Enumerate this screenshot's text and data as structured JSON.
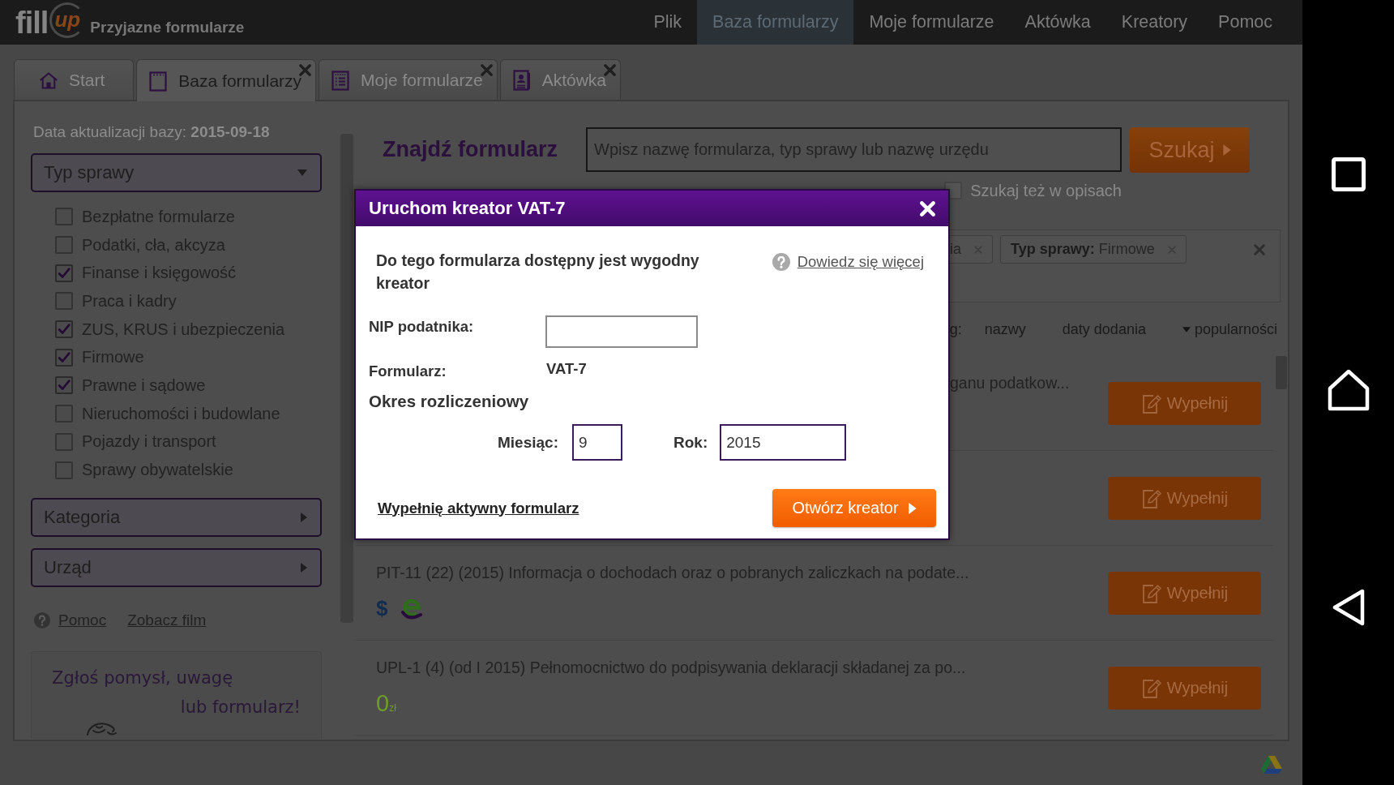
{
  "header": {
    "logo": {
      "word": "fill",
      "swash": "up",
      "tagline": "Przyjazne formularze"
    },
    "menu": [
      {
        "label": "Plik",
        "selected": false
      },
      {
        "label": "Baza formularzy",
        "selected": true
      },
      {
        "label": "Moje formularze",
        "selected": false
      },
      {
        "label": "Aktówka",
        "selected": false
      },
      {
        "label": "Kreatory",
        "selected": false
      },
      {
        "label": "Pomoc",
        "selected": false
      }
    ]
  },
  "tabs": [
    {
      "label": "Start",
      "kind": "home",
      "selected": false,
      "closable": false
    },
    {
      "label": "Baza formularzy",
      "kind": "notepad",
      "selected": true,
      "closable": true
    },
    {
      "label": "Moje formularze",
      "kind": "list",
      "selected": false,
      "closable": true
    },
    {
      "label": "Aktówka",
      "kind": "person-file",
      "selected": false,
      "closable": true
    }
  ],
  "sidebar": {
    "update_label": "Data aktualizacji bazy:",
    "update_date": "2015-09-18",
    "case_type": {
      "label": "Typ sprawy",
      "expanded": true,
      "options": [
        {
          "label": "Bezpłatne formularze",
          "checked": false
        },
        {
          "label": "Podatki, cła, akcyza",
          "checked": false
        },
        {
          "label": "Finanse i księgowość",
          "checked": true
        },
        {
          "label": "Praca i kadry",
          "checked": false
        },
        {
          "label": "ZUS, KRUS i ubezpieczenia",
          "checked": true
        },
        {
          "label": "Firmowe",
          "checked": true
        },
        {
          "label": "Prawne i sądowe",
          "checked": true
        },
        {
          "label": "Nieruchomości i budowlane",
          "checked": false
        },
        {
          "label": "Pojazdy i transport",
          "checked": false
        },
        {
          "label": "Sprawy obywatelskie",
          "checked": false
        }
      ]
    },
    "sections": [
      {
        "label": "Kategoria",
        "expanded": false
      },
      {
        "label": "Urząd",
        "expanded": false
      }
    ],
    "links": [
      {
        "label": "Pomoc",
        "kind": "help"
      },
      {
        "label": "Zobacz film",
        "kind": "plain"
      }
    ],
    "feedback": {
      "lines": [
        "Zgłoś pomysł, uwagę",
        "lub formularz!"
      ]
    }
  },
  "search": {
    "title": "Znajdź formularz",
    "placeholder": "Wpisz nazwę formularza, typ sprawy lub nazwę urzędu",
    "button": "Szukaj",
    "in_descriptions": {
      "label": "Szukaj też w opisach",
      "checked": false
    }
  },
  "filters": {
    "tags": [
      {
        "value": "ia"
      },
      {
        "label": "Typ sprawy:",
        "value": "Firmowe"
      }
    ]
  },
  "sort": {
    "label": "g:",
    "options": [
      {
        "label": "nazwy",
        "selected": false
      },
      {
        "label": "daty dodania",
        "selected": false
      },
      {
        "label": "popularności",
        "selected": true
      }
    ]
  },
  "results": [
    {
      "title": "ganu podatkow...",
      "button": "Wypełnij"
    },
    {
      "button": "Wypełnij"
    },
    {
      "title": "PIT-11 (22) (2015) Informacja o dochodach oraz o pobranych zaliczkach na podate...",
      "badges": [
        {
          "kind": "paid",
          "text": "$"
        },
        {
          "kind": "e-filing"
        }
      ],
      "button": "Wypełnij"
    },
    {
      "title": "UPL-1 (4) (od I 2015) Pełnomocnictwo do podpisywania deklaracji składanej za po...",
      "badges": [
        {
          "kind": "free",
          "text": "0",
          "unit": "zł"
        }
      ],
      "button": "Wypełnij"
    }
  ],
  "modal": {
    "title": "Uruchom kreator VAT-7",
    "intro": "Do tego formularza dostępny jest wygodny kreator",
    "help_link": "Dowiedz się więcej",
    "nip": {
      "label": "NIP podatnika:"
    },
    "form": {
      "label": "Formularz:",
      "value": "VAT-7"
    },
    "period": {
      "title": "Okres rozliczeniowy",
      "month": {
        "label": "Miesiąc:",
        "value": "9"
      },
      "year": {
        "label": "Rok:",
        "value": "2015"
      }
    },
    "alt_link": "Wypełnię aktywny formularz",
    "primary_button": "Otwórz kreator"
  }
}
